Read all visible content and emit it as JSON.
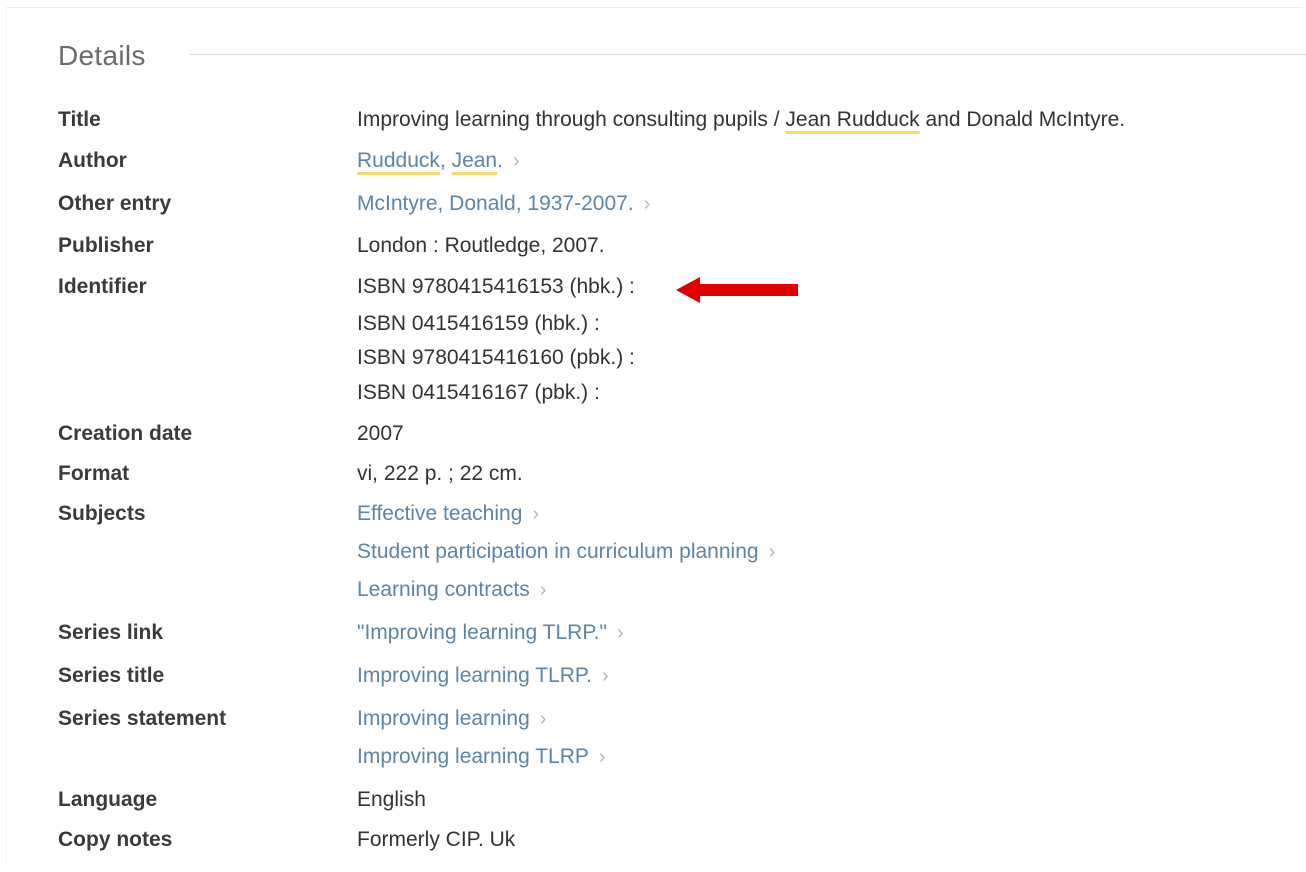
{
  "details": {
    "heading": "Details",
    "title": {
      "label": "Title",
      "before": "Improving learning through consulting pupils / ",
      "highlight": "Jean Rudduck",
      "after": " and Donald McIntyre."
    },
    "author": {
      "label": "Author",
      "part1": "Rudduck",
      "sep": ", ",
      "part2": "Jean",
      "end": ".",
      "chevron": "›"
    },
    "other_entry": {
      "label": "Other entry",
      "value": "McIntyre, Donald, 1937-2007.",
      "chevron": "›"
    },
    "publisher": {
      "label": "Publisher",
      "value": "London : Routledge, 2007."
    },
    "identifier": {
      "label": "Identifier",
      "values": [
        "ISBN 9780415416153 (hbk.) :",
        "ISBN 0415416159 (hbk.) :",
        "ISBN 9780415416160 (pbk.) :",
        "ISBN 0415416167 (pbk.) :"
      ]
    },
    "creation_date": {
      "label": "Creation date",
      "value": "2007"
    },
    "format": {
      "label": "Format",
      "value": "vi, 222 p. ; 22 cm."
    },
    "subjects": {
      "label": "Subjects",
      "values": [
        "Effective teaching",
        "Student participation in curriculum planning",
        "Learning contracts"
      ],
      "chevron": "›"
    },
    "series_link": {
      "label": "Series link",
      "value": "\"Improving learning TLRP.\"",
      "chevron": "›"
    },
    "series_title": {
      "label": "Series title",
      "value": "Improving learning TLRP.",
      "chevron": "›"
    },
    "series_statement": {
      "label": "Series statement",
      "values": [
        "Improving learning",
        "Improving learning TLRP"
      ],
      "chevron": "›"
    },
    "language": {
      "label": "Language",
      "value": "English"
    },
    "copy_notes": {
      "label": "Copy notes",
      "value": "Formerly CIP. Uk"
    }
  },
  "colors": {
    "link": "#5b86a8",
    "highlight_underline": "#f4dc6a",
    "arrow": "#e00000"
  }
}
